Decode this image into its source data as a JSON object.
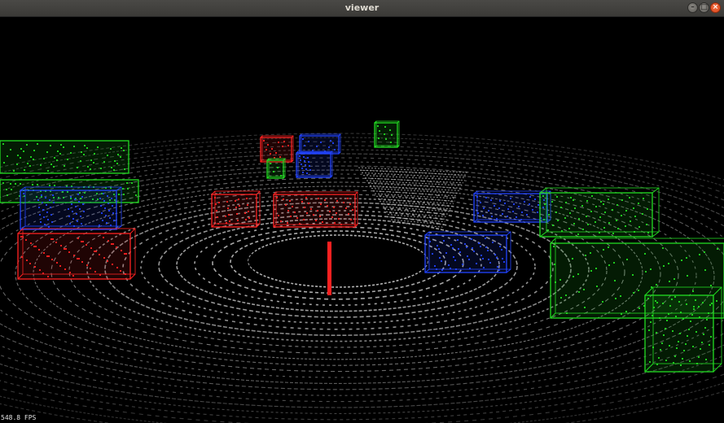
{
  "window": {
    "title": "viewer",
    "controls": [
      "minimize",
      "maximize",
      "close"
    ]
  },
  "viewport": {
    "background": "#000000",
    "fps_text": "548.8 FPS",
    "point_color": "#cfcfcf",
    "ego_marker_color": "#ff2020",
    "box_colors": {
      "red": "#ff2222",
      "green": "#22dd22",
      "blue": "#2244ff"
    }
  },
  "icons": {
    "minimize": "minimize-icon",
    "maximize": "maximize-icon",
    "close": "close-icon"
  }
}
